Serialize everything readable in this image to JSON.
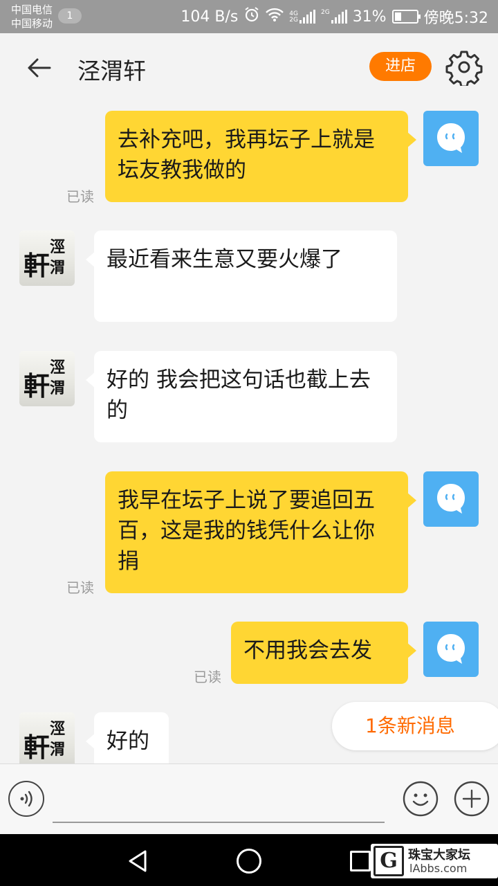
{
  "status_bar": {
    "carrier_1": "中国电信",
    "carrier_2": "中国移动",
    "notification_count": "1",
    "net_speed": "104 B/s",
    "net_tag_1": "4G",
    "net_tag_2": "2G",
    "net_tag_3": "2G",
    "battery": "31%",
    "battery_level": 0.31,
    "time": "傍晚5:32"
  },
  "header": {
    "title": "泾渭轩",
    "enter_shop": "进店"
  },
  "shop_avatar_text": "軒涇渭",
  "messages": [
    {
      "side": "out",
      "text": "去补充吧，我再坛子上就是坛友教我做的",
      "status": "已读"
    },
    {
      "side": "in",
      "text": "最近看来生意又要火爆了"
    },
    {
      "side": "in",
      "text": "好的 我会把这句话也截上去的"
    },
    {
      "side": "out",
      "text": "我早在坛子上说了要追回五百，这是我的钱凭什么让你捐",
      "status": "已读"
    },
    {
      "side": "out",
      "text": "不用我会去发",
      "status": "已读"
    },
    {
      "side": "in",
      "text": "好的"
    }
  ],
  "new_message_tip": "1条新消息",
  "watermark": {
    "title": "珠宝大家坛",
    "subtitle": "lAbbs.com",
    "logo_letter": "G"
  },
  "colors": {
    "bubble_out": "#ffd633",
    "accent_orange": "#ff7a00",
    "self_avatar": "#4fb0f2"
  }
}
